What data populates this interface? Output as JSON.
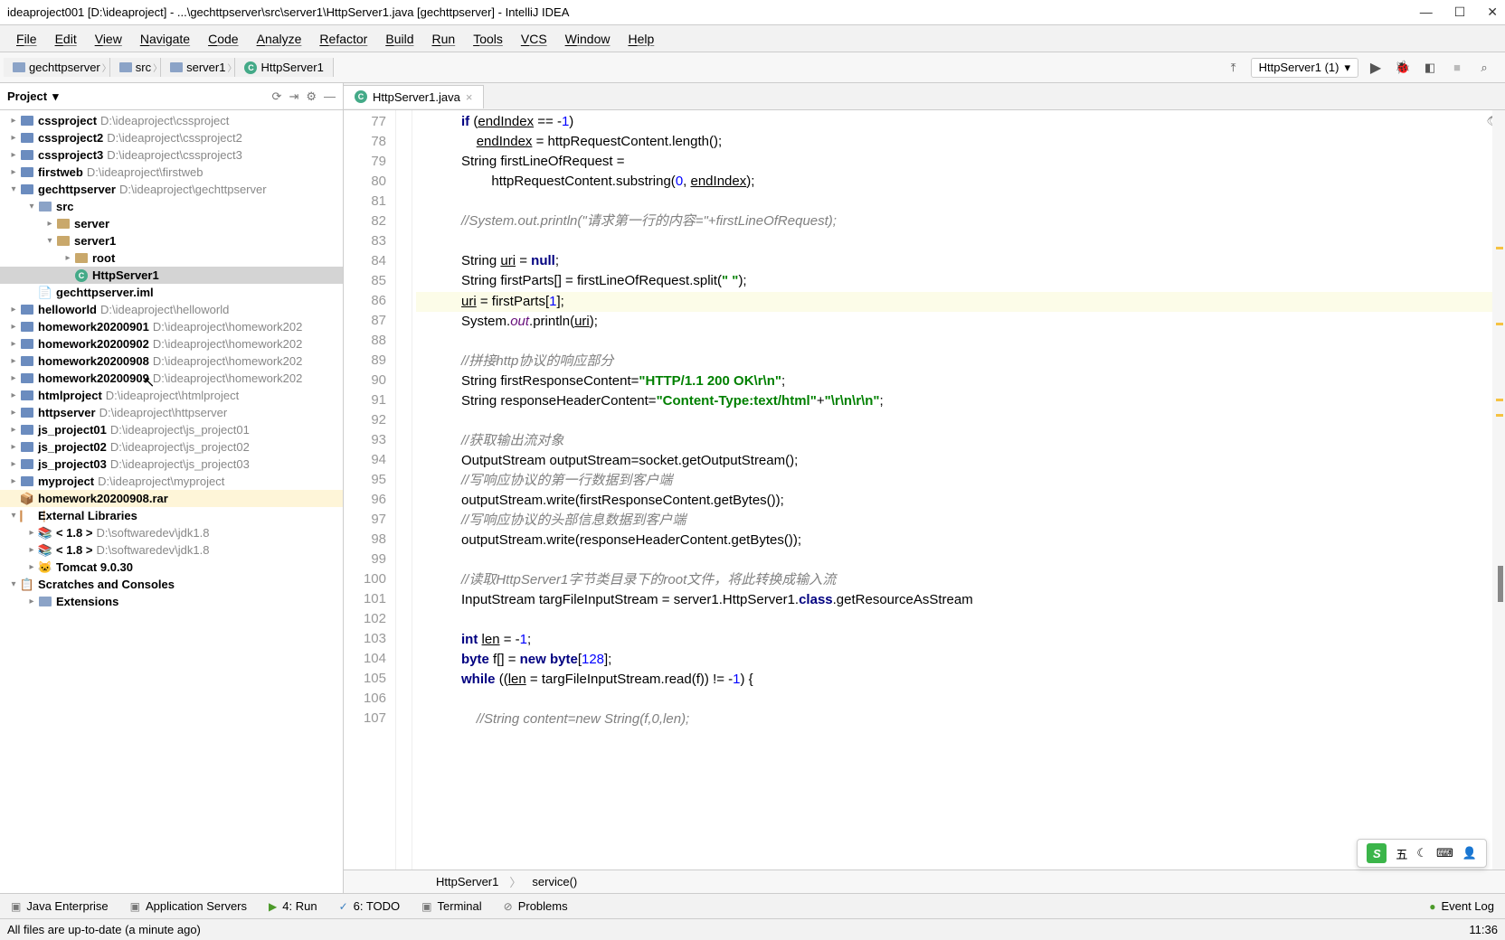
{
  "title": "ideaproject001 [D:\\ideaproject] - ...\\gechttpserver\\src\\server1\\HttpServer1.java [gechttpserver] - IntelliJ IDEA",
  "menu": [
    "File",
    "Edit",
    "View",
    "Navigate",
    "Code",
    "Analyze",
    "Refactor",
    "Build",
    "Run",
    "Tools",
    "VCS",
    "Window",
    "Help"
  ],
  "breadcrumb": [
    {
      "icon": "module",
      "label": "gechttpserver"
    },
    {
      "icon": "folder",
      "label": "src"
    },
    {
      "icon": "folder",
      "label": "server1"
    },
    {
      "icon": "class",
      "label": "HttpServer1"
    }
  ],
  "runConfig": "HttpServer1 (1)",
  "projectPanel": {
    "title": "Project"
  },
  "tree": [
    {
      "depth": 0,
      "arrow": "▸",
      "icon": "module",
      "label": "cssproject",
      "path": "D:\\ideaproject\\cssproject"
    },
    {
      "depth": 0,
      "arrow": "▸",
      "icon": "module",
      "label": "cssproject2",
      "path": "D:\\ideaproject\\cssproject2"
    },
    {
      "depth": 0,
      "arrow": "▸",
      "icon": "module",
      "label": "cssproject3",
      "path": "D:\\ideaproject\\cssproject3"
    },
    {
      "depth": 0,
      "arrow": "▸",
      "icon": "module",
      "label": "firstweb",
      "path": "D:\\ideaproject\\firstweb"
    },
    {
      "depth": 0,
      "arrow": "▾",
      "icon": "module",
      "label": "gechttpserver",
      "path": "D:\\ideaproject\\gechttpserver"
    },
    {
      "depth": 1,
      "arrow": "▾",
      "icon": "folder",
      "label": "src",
      "path": ""
    },
    {
      "depth": 2,
      "arrow": "▸",
      "icon": "pkg",
      "label": "server",
      "path": ""
    },
    {
      "depth": 2,
      "arrow": "▾",
      "icon": "pkg",
      "label": "server1",
      "path": ""
    },
    {
      "depth": 3,
      "arrow": "▸",
      "icon": "pkg",
      "label": "root",
      "path": ""
    },
    {
      "depth": 3,
      "arrow": "",
      "icon": "class",
      "label": "HttpServer1",
      "path": "",
      "selected": true
    },
    {
      "depth": 1,
      "arrow": "",
      "icon": "iml",
      "label": "gechttpserver.iml",
      "path": ""
    },
    {
      "depth": 0,
      "arrow": "▸",
      "icon": "module",
      "label": "helloworld",
      "path": "D:\\ideaproject\\helloworld"
    },
    {
      "depth": 0,
      "arrow": "▸",
      "icon": "module",
      "label": "homework20200901",
      "path": "D:\\ideaproject\\homework202"
    },
    {
      "depth": 0,
      "arrow": "▸",
      "icon": "module",
      "label": "homework20200902",
      "path": "D:\\ideaproject\\homework202"
    },
    {
      "depth": 0,
      "arrow": "▸",
      "icon": "module",
      "label": "homework20200908",
      "path": "D:\\ideaproject\\homework202"
    },
    {
      "depth": 0,
      "arrow": "▸",
      "icon": "module",
      "label": "homework20200909",
      "path": "D:\\ideaproject\\homework202"
    },
    {
      "depth": 0,
      "arrow": "▸",
      "icon": "module",
      "label": "htmlproject",
      "path": "D:\\ideaproject\\htmlproject"
    },
    {
      "depth": 0,
      "arrow": "▸",
      "icon": "module",
      "label": "httpserver",
      "path": "D:\\ideaproject\\httpserver"
    },
    {
      "depth": 0,
      "arrow": "▸",
      "icon": "module",
      "label": "js_project01",
      "path": "D:\\ideaproject\\js_project01"
    },
    {
      "depth": 0,
      "arrow": "▸",
      "icon": "module",
      "label": "js_project02",
      "path": "D:\\ideaproject\\js_project02"
    },
    {
      "depth": 0,
      "arrow": "▸",
      "icon": "module",
      "label": "js_project03",
      "path": "D:\\ideaproject\\js_project03"
    },
    {
      "depth": 0,
      "arrow": "▸",
      "icon": "module",
      "label": "myproject",
      "path": "D:\\ideaproject\\myproject"
    },
    {
      "depth": 0,
      "arrow": "",
      "icon": "rar",
      "label": "homework20200908.rar",
      "path": "",
      "rar": true
    },
    {
      "depth": 0,
      "arrow": "▾",
      "icon": "lib",
      "label": "External Libraries",
      "path": ""
    },
    {
      "depth": 1,
      "arrow": "▸",
      "icon": "jdk",
      "label": "< 1.8 >",
      "path": "D:\\softwaredev\\jdk1.8"
    },
    {
      "depth": 1,
      "arrow": "▸",
      "icon": "jdk",
      "label": "< 1.8 >",
      "path": "D:\\softwaredev\\jdk1.8"
    },
    {
      "depth": 1,
      "arrow": "▸",
      "icon": "tc",
      "label": "Tomcat 9.0.30",
      "path": ""
    },
    {
      "depth": 0,
      "arrow": "▾",
      "icon": "scratch",
      "label": "Scratches and Consoles",
      "path": ""
    },
    {
      "depth": 1,
      "arrow": "▸",
      "icon": "folder",
      "label": "Extensions",
      "path": ""
    }
  ],
  "tab": {
    "name": "HttpServer1.java"
  },
  "gutterStart": 77,
  "code": [
    {
      "t": "            <kw>if</kw> (<uline>endIndex</uline> == -<num>1</num>)"
    },
    {
      "t": "                <uline>endIndex</uline> = httpRequestContent.length();"
    },
    {
      "t": "            String firstLineOfRequest ="
    },
    {
      "t": "                    httpRequestContent.substring(<num>0</num>, <uline>endIndex</uline>);"
    },
    {
      "t": ""
    },
    {
      "t": "            <cm>//System.out.println(\"请求第一行的内容=\"+firstLineOfRequest);</cm>"
    },
    {
      "t": ""
    },
    {
      "t": "            String <uline>uri</uline> = <kw>null</kw>;"
    },
    {
      "t": "            String firstParts[] = firstLineOfRequest.split(<str>\" \"</str>);"
    },
    {
      "t": "            <uline>uri</uline> = firstParts[<num>1</num>];",
      "cur": true
    },
    {
      "t": "            System.<fld>out</fld>.println(<uline>uri</uline>);"
    },
    {
      "t": ""
    },
    {
      "t": "            <cm>//拼接http协议的响应部分</cm>"
    },
    {
      "t": "            String firstResponseContent=<str>\"HTTP/1.1 200 OK\\r\\n\"</str>;"
    },
    {
      "t": "            String responseHeaderContent=<str>\"Content-Type:text/html\"</str>+<str>\"\\r\\n\\r\\n\"</str>;"
    },
    {
      "t": ""
    },
    {
      "t": "            <cm>//获取输出流对象</cm>"
    },
    {
      "t": "            OutputStream outputStream=socket.getOutputStream();"
    },
    {
      "t": "            <cm>//写响应协议的第一行数据到客户端</cm>"
    },
    {
      "t": "            outputStream.write(firstResponseContent.getBytes());"
    },
    {
      "t": "            <cm>//写响应协议的头部信息数据到客户端</cm>"
    },
    {
      "t": "            outputStream.write(responseHeaderContent.getBytes());"
    },
    {
      "t": ""
    },
    {
      "t": "            <cm>//读取HttpServer1字节类目录下的root文件，将此转换成输入流</cm>"
    },
    {
      "t": "            InputStream targFileInputStream = server1.HttpServer1.<kw>class</kw>.getResourceAsStream"
    },
    {
      "t": ""
    },
    {
      "t": "            <kw>int</kw> <uline>len</uline> = -<num>1</num>;"
    },
    {
      "t": "            <kw>byte</kw> f[] = <kw>new byte</kw>[<num>128</num>];"
    },
    {
      "t": "            <kw>while</kw> ((<uline>len</uline> = targFileInputStream.read(f)) != -<num>1</num>) {"
    },
    {
      "t": ""
    },
    {
      "t": "                <cm>//String content=new String(f,0,len);</cm>"
    }
  ],
  "codeCrumb": [
    "HttpServer1",
    "service()"
  ],
  "toolWindows": [
    {
      "icon": "je",
      "label": "Java Enterprise"
    },
    {
      "icon": "as",
      "label": "Application Servers"
    },
    {
      "icon": "run",
      "label": "4: Run"
    },
    {
      "icon": "todo",
      "label": "6: TODO"
    },
    {
      "icon": "term",
      "label": "Terminal"
    },
    {
      "icon": "prob",
      "label": "Problems"
    }
  ],
  "eventLog": "Event Log",
  "status": "All files are up-to-date (a minute ago)",
  "clock": "11:36",
  "ime": {
    "logo": "S",
    "mode": "五",
    "icons": [
      "☾",
      "⌨",
      "👤"
    ]
  }
}
